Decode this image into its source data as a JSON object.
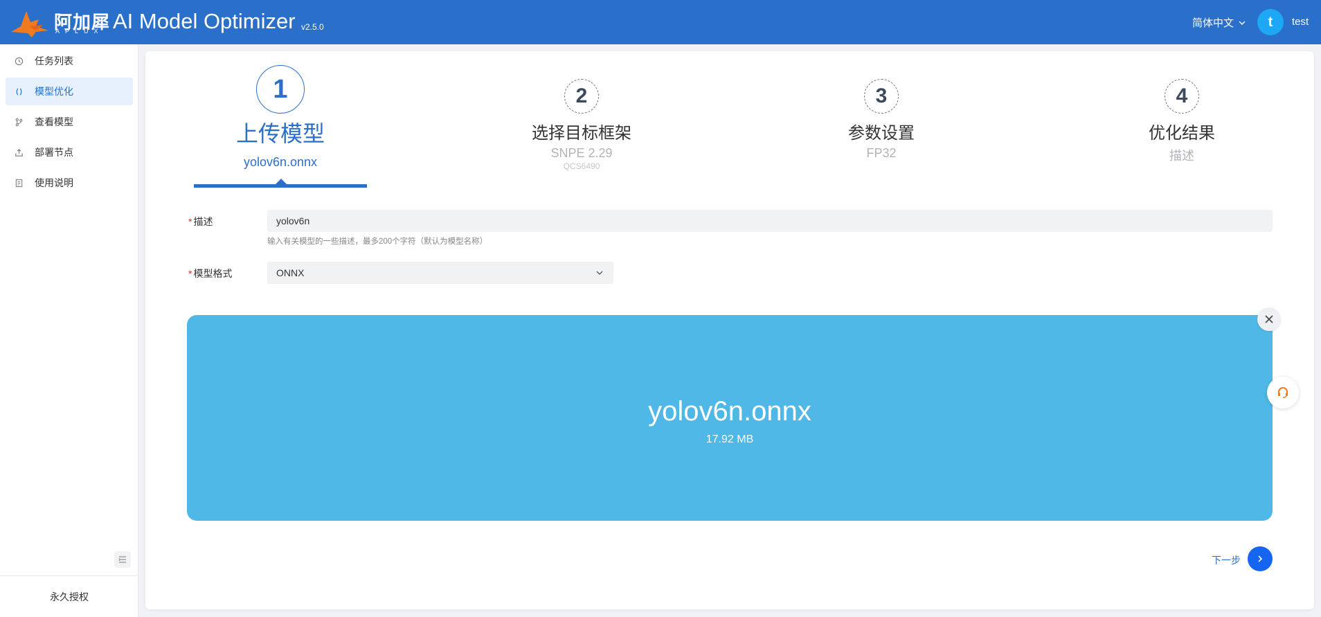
{
  "header": {
    "logo_cn": "阿加犀",
    "logo_en": "APLUX",
    "title": "AI Model Optimizer",
    "version": "v2.5.0",
    "language": "简体中文",
    "avatar_letter": "t",
    "username": "test",
    "bg_color": "#2a6fc9"
  },
  "sidebar": {
    "items": [
      {
        "label": "任务列表",
        "icon": "history-icon",
        "active": false
      },
      {
        "label": "模型优化",
        "icon": "model-optimize-icon",
        "active": true
      },
      {
        "label": "查看模型",
        "icon": "branch-icon",
        "active": false
      },
      {
        "label": "部署节点",
        "icon": "upload-icon",
        "active": false
      },
      {
        "label": "使用说明",
        "icon": "doc-icon",
        "active": false
      }
    ],
    "footer": "永久授权"
  },
  "steps": [
    {
      "number": "1",
      "title": "上传模型",
      "sub": "yolov6n.onnx",
      "active": true
    },
    {
      "number": "2",
      "title": "选择目标框架",
      "sub": "SNPE 2.29",
      "sub2": "QCS6490",
      "active": false
    },
    {
      "number": "3",
      "title": "参数设置",
      "sub": "FP32",
      "active": false
    },
    {
      "number": "4",
      "title": "优化结果",
      "sub": "描述",
      "active": false
    }
  ],
  "form": {
    "desc_label": "描述",
    "desc_value": "yolov6n",
    "desc_hint": "输入有关模型的一些描述，最多200个字符（默认为模型名称）",
    "format_label": "模型格式",
    "format_value": "ONNX",
    "required_mark": "*"
  },
  "upload": {
    "file_name": "yolov6n.onnx",
    "file_size": "17.92 MB",
    "color": "#4fb8e6"
  },
  "actions": {
    "next_label": "下一步"
  }
}
